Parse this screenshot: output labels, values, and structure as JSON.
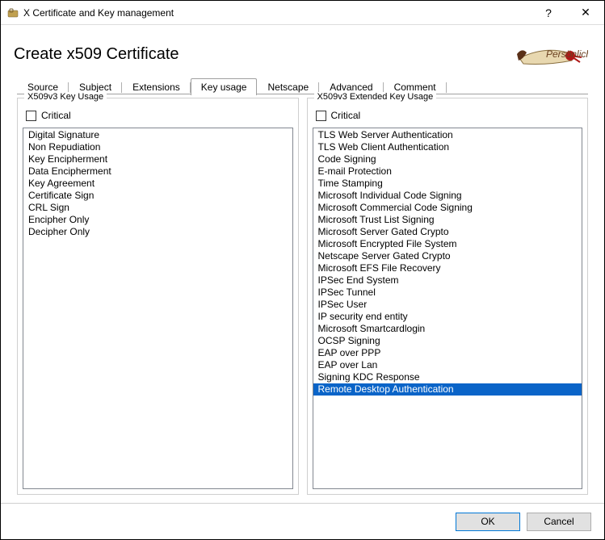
{
  "window": {
    "title": "X Certificate and Key management",
    "help_glyph": "?",
    "close_glyph": "✕"
  },
  "page_title": "Create x509 Certificate",
  "tabs": [
    {
      "label": "Source"
    },
    {
      "label": "Subject"
    },
    {
      "label": "Extensions"
    },
    {
      "label": "Key usage",
      "active": true
    },
    {
      "label": "Netscape"
    },
    {
      "label": "Advanced"
    },
    {
      "label": "Comment"
    }
  ],
  "key_usage": {
    "legend": "X509v3 Key Usage",
    "critical_label": "Critical",
    "critical_checked": false,
    "items": [
      "Digital Signature",
      "Non Repudiation",
      "Key Encipherment",
      "Data Encipherment",
      "Key Agreement",
      "Certificate Sign",
      "CRL Sign",
      "Encipher Only",
      "Decipher Only"
    ]
  },
  "ext_key_usage": {
    "legend": "X509v3 Extended Key Usage",
    "critical_label": "Critical",
    "critical_checked": false,
    "selected_index": 22,
    "items": [
      "TLS Web Server Authentication",
      "TLS Web Client Authentication",
      "Code Signing",
      "E-mail Protection",
      "Time Stamping",
      "Microsoft Individual Code Signing",
      "Microsoft Commercial Code Signing",
      "Microsoft Trust List Signing",
      "Microsoft Server Gated Crypto",
      "Microsoft Encrypted File System",
      "Netscape Server Gated Crypto",
      "Microsoft EFS File Recovery",
      "IPSec End System",
      "IPSec Tunnel",
      "IPSec User",
      "IP security end entity",
      "Microsoft Smartcardlogin",
      "OCSP Signing",
      "EAP over PPP",
      "EAP over Lan",
      "Signing KDC Response",
      "Remote Desktop Authentication"
    ]
  },
  "footer": {
    "ok": "OK",
    "cancel": "Cancel"
  }
}
